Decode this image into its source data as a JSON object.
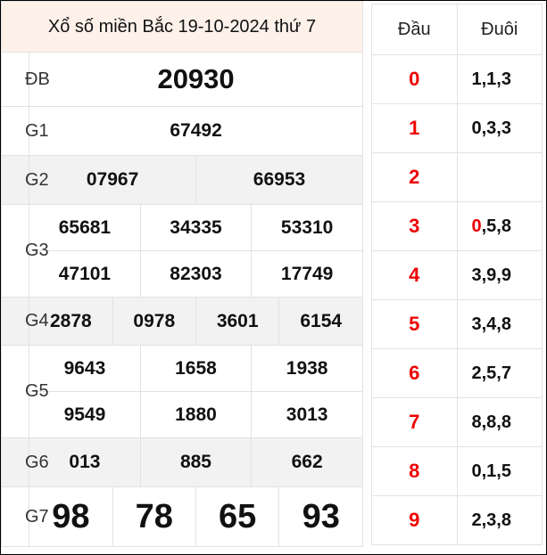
{
  "title": "Xổ số miền Bắc 19-10-2024 thứ 7",
  "prizes": {
    "db": {
      "label": "ĐB",
      "numbers": [
        "20930"
      ]
    },
    "g1": {
      "label": "G1",
      "numbers": [
        "67492"
      ]
    },
    "g2": {
      "label": "G2",
      "numbers": [
        "07967",
        "66953"
      ]
    },
    "g3": {
      "label": "G3",
      "numbers": [
        "65681",
        "34335",
        "53310",
        "47101",
        "82303",
        "17749"
      ]
    },
    "g4": {
      "label": "G4",
      "numbers": [
        "2878",
        "0978",
        "3601",
        "6154"
      ]
    },
    "g5": {
      "label": "G5",
      "numbers": [
        "9643",
        "1658",
        "1938",
        "9549",
        "1880",
        "3013"
      ]
    },
    "g6": {
      "label": "G6",
      "numbers": [
        "013",
        "885",
        "662"
      ]
    },
    "g7": {
      "label": "G7",
      "numbers": [
        "98",
        "78",
        "65",
        "93"
      ]
    }
  },
  "loto": {
    "head_label": "Đầu",
    "tail_label": "Đuôi",
    "rows": [
      {
        "head": "0",
        "tail": "1,1,3"
      },
      {
        "head": "1",
        "tail": "0,3,3"
      },
      {
        "head": "2",
        "tail": ""
      },
      {
        "head": "3",
        "tail_first": "0",
        "tail_rest": ",5,8"
      },
      {
        "head": "4",
        "tail": "3,9,9"
      },
      {
        "head": "5",
        "tail": "3,4,8"
      },
      {
        "head": "6",
        "tail": "2,5,7"
      },
      {
        "head": "7",
        "tail": "8,8,8"
      },
      {
        "head": "8",
        "tail": "0,1,5"
      },
      {
        "head": "9",
        "tail": "2,3,8"
      }
    ]
  },
  "colors": {
    "highlight": "#e0403a",
    "title_bg": "#fdf1ea",
    "alt_row_bg": "#f2f2f2",
    "head_digit": "#ee0000"
  }
}
